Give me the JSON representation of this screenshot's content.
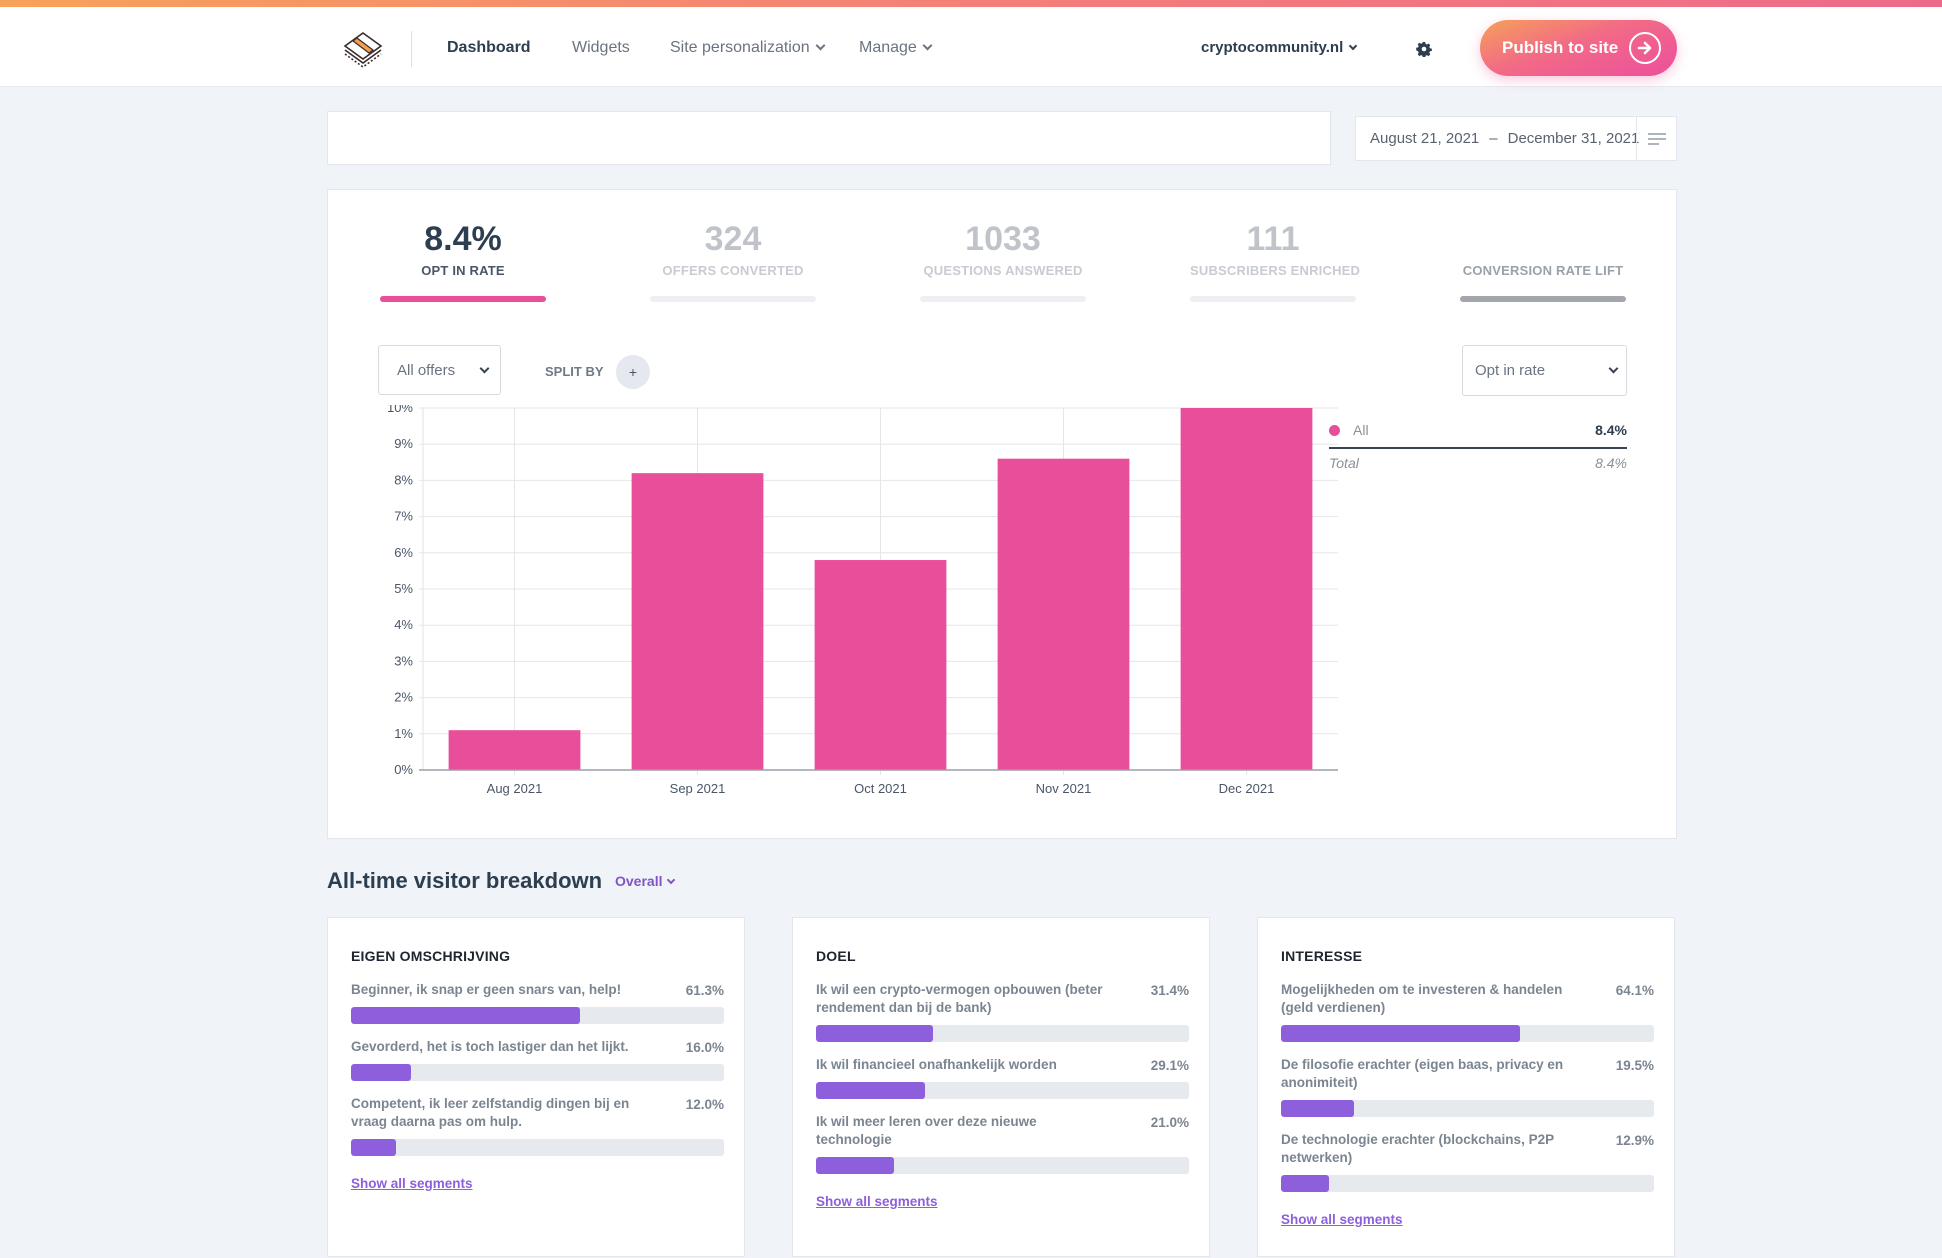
{
  "nav": {
    "items": [
      {
        "label": "Dashboard",
        "active": true,
        "dropdown": false
      },
      {
        "label": "Widgets",
        "active": false,
        "dropdown": false
      },
      {
        "label": "Site personalization",
        "active": false,
        "dropdown": true
      },
      {
        "label": "Manage",
        "active": false,
        "dropdown": true
      }
    ],
    "site": "cryptocommunity.nl",
    "settings_icon": "gear-icon",
    "publish_label": "Publish to site",
    "publish_icon": "arrow-right-circle-icon"
  },
  "filters": {
    "search_value": "",
    "date_start": "August 21, 2021",
    "date_separator": "–",
    "date_end": "December 31, 2021",
    "filter_icon": "filter-lines-icon"
  },
  "kpis": [
    {
      "value": "8.4%",
      "label": "OPT IN RATE",
      "active": true
    },
    {
      "value": "324",
      "label": "OFFERS CONVERTED",
      "active": false
    },
    {
      "value": "1033",
      "label": "QUESTIONS ANSWERED",
      "active": false
    },
    {
      "value": "111",
      "label": "SUBSCRIBERS ENRICHED",
      "active": false
    },
    {
      "value": "",
      "label": "CONVERSION RATE LIFT",
      "active": false
    }
  ],
  "chart_controls": {
    "offer_select": "All offers",
    "split_by_label": "SPLIT BY",
    "split_add": "+",
    "metric_select": "Opt in rate"
  },
  "chart_data": {
    "type": "bar",
    "title": "",
    "xlabel": "",
    "ylabel": "",
    "categories": [
      "Aug 2021",
      "Sep 2021",
      "Oct 2021",
      "Nov 2021",
      "Dec 2021"
    ],
    "series": [
      {
        "name": "All",
        "color": "#e94e9a",
        "values": [
          1.1,
          8.2,
          5.8,
          8.6,
          10.0
        ]
      }
    ],
    "ylim": [
      0,
      10
    ],
    "yticks": [
      "0%",
      "1%",
      "2%",
      "3%",
      "4%",
      "5%",
      "6%",
      "7%",
      "8%",
      "9%",
      "10%"
    ],
    "grid": true,
    "legend": "right"
  },
  "legend": {
    "entries": [
      {
        "name": "All",
        "value": "8.4%",
        "color": "#e94e9a"
      }
    ],
    "total_label": "Total",
    "total_value": "8.4%"
  },
  "breakdown": {
    "title": "All-time visitor breakdown",
    "scope": "Overall",
    "show_all_label": "Show all segments",
    "cards": [
      {
        "title": "EIGEN OMSCHRIJVING",
        "items": [
          {
            "label": "Beginner, ik snap er geen snars van, help!",
            "pct": "61.3%",
            "value": 61.3
          },
          {
            "label": "Gevorderd, het is toch lastiger dan het lijkt.",
            "pct": "16.0%",
            "value": 16.0
          },
          {
            "label": "Competent, ik leer zelfstandig dingen bij en vraag daarna pas om hulp.",
            "pct": "12.0%",
            "value": 12.0
          }
        ]
      },
      {
        "title": "DOEL",
        "items": [
          {
            "label": "Ik wil een crypto-vermogen opbouwen (beter rendement dan bij de bank)",
            "pct": "31.4%",
            "value": 31.4
          },
          {
            "label": "Ik wil financieel onafhankelijk worden",
            "pct": "29.1%",
            "value": 29.1
          },
          {
            "label": "Ik wil meer leren over deze nieuwe technologie",
            "pct": "21.0%",
            "value": 21.0
          }
        ]
      },
      {
        "title": "INTERESSE",
        "items": [
          {
            "label": "Mogelijkheden om te investeren & handelen (geld verdienen)",
            "pct": "64.1%",
            "value": 64.1
          },
          {
            "label": "De filosofie erachter (eigen baas, privacy en anonimiteit)",
            "pct": "19.5%",
            "value": 19.5
          },
          {
            "label": "De technologie erachter (blockchains, P2P netwerken)",
            "pct": "12.9%",
            "value": 12.9
          }
        ]
      }
    ]
  }
}
